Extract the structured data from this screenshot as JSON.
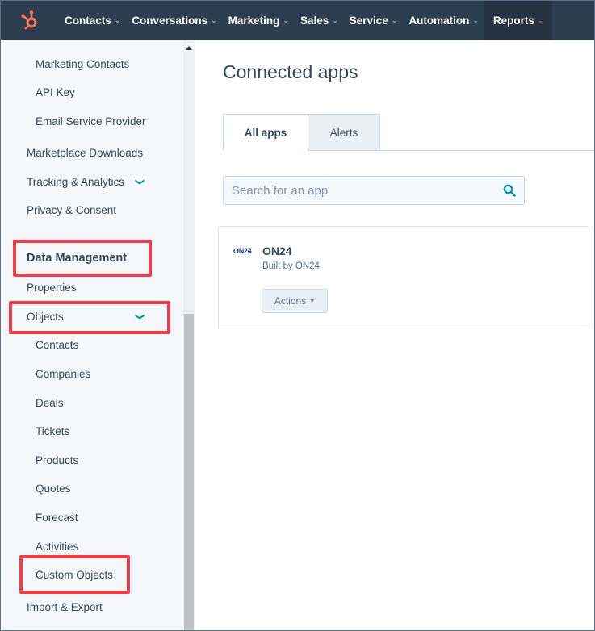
{
  "nav": {
    "items": [
      {
        "label": "Contacts"
      },
      {
        "label": "Conversations"
      },
      {
        "label": "Marketing"
      },
      {
        "label": "Sales"
      },
      {
        "label": "Service"
      },
      {
        "label": "Automation"
      },
      {
        "label": "Reports",
        "active": true
      }
    ],
    "chevron": "⌄"
  },
  "sidebar": {
    "marketing_contacts": "Marketing Contacts",
    "api_key": "API Key",
    "email_service_provider": "Email Service Provider",
    "marketplace_downloads": "Marketplace Downloads",
    "tracking_analytics": "Tracking & Analytics",
    "privacy_consent": "Privacy & Consent",
    "data_management": "Data Management",
    "properties": "Properties",
    "objects": "Objects",
    "contacts": "Contacts",
    "companies": "Companies",
    "deals": "Deals",
    "tickets": "Tickets",
    "products": "Products",
    "quotes": "Quotes",
    "forecast": "Forecast",
    "activities": "Activities",
    "custom_objects": "Custom Objects",
    "import_export": "Import & Export"
  },
  "main": {
    "title": "Connected apps",
    "tabs": [
      "All apps",
      "Alerts"
    ],
    "search_placeholder": "Search for an app",
    "app": {
      "logo_text": "ON24",
      "name": "ON24",
      "built_by": "Built by ON24",
      "actions_label": "Actions"
    }
  },
  "colors": {
    "nav_bg": "#2d3e50",
    "highlight": "#ef3e4a",
    "accent": "#0091ae",
    "logo": "#ff7a59"
  }
}
